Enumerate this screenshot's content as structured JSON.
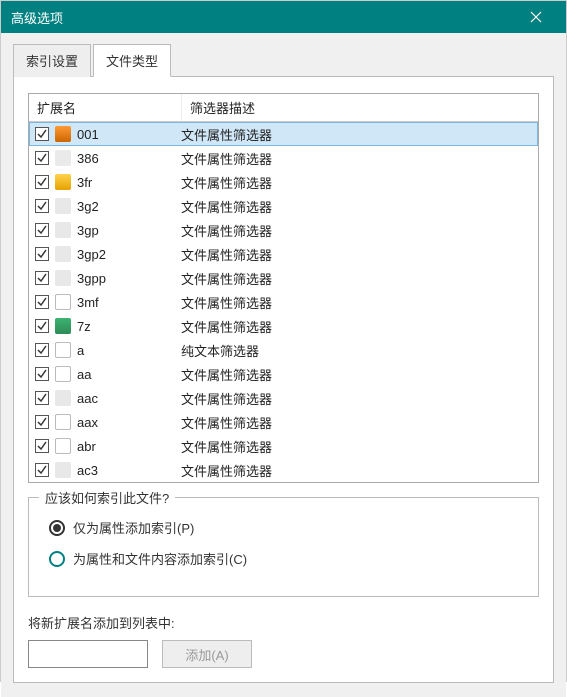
{
  "window": {
    "title": "高级选项"
  },
  "tabs": [
    {
      "label": "索引设置",
      "active": false
    },
    {
      "label": "文件类型",
      "active": true
    }
  ],
  "columns": {
    "ext": "扩展名",
    "desc": "筛选器描述"
  },
  "rows": [
    {
      "checked": true,
      "ext": "001",
      "desc": "文件属性筛选器",
      "icon": "ic-orange",
      "selected": true
    },
    {
      "checked": true,
      "ext": "386",
      "desc": "文件属性筛选器",
      "icon": "ic-gear"
    },
    {
      "checked": true,
      "ext": "3fr",
      "desc": "文件属性筛选器",
      "icon": "ic-yellow"
    },
    {
      "checked": true,
      "ext": "3g2",
      "desc": "文件属性筛选器",
      "icon": "ic-media"
    },
    {
      "checked": true,
      "ext": "3gp",
      "desc": "文件属性筛选器",
      "icon": "ic-media"
    },
    {
      "checked": true,
      "ext": "3gp2",
      "desc": "文件属性筛选器",
      "icon": "ic-media"
    },
    {
      "checked": true,
      "ext": "3gpp",
      "desc": "文件属性筛选器",
      "icon": "ic-media"
    },
    {
      "checked": true,
      "ext": "3mf",
      "desc": "文件属性筛选器",
      "icon": "ic-doc"
    },
    {
      "checked": true,
      "ext": "7z",
      "desc": "文件属性筛选器",
      "icon": "ic-7z"
    },
    {
      "checked": true,
      "ext": "a",
      "desc": "纯文本筛选器",
      "icon": "ic-doc"
    },
    {
      "checked": true,
      "ext": "aa",
      "desc": "文件属性筛选器",
      "icon": "ic-doc"
    },
    {
      "checked": true,
      "ext": "aac",
      "desc": "文件属性筛选器",
      "icon": "ic-media"
    },
    {
      "checked": true,
      "ext": "aax",
      "desc": "文件属性筛选器",
      "icon": "ic-doc"
    },
    {
      "checked": true,
      "ext": "abr",
      "desc": "文件属性筛选器",
      "icon": "ic-doc"
    },
    {
      "checked": true,
      "ext": "ac3",
      "desc": "文件属性筛选器",
      "icon": "ic-media"
    }
  ],
  "index_group": {
    "title": "应该如何索引此文件?",
    "opts": [
      {
        "label": "仅为属性添加索引(P)",
        "selected": true
      },
      {
        "label": "为属性和文件内容添加索引(C)",
        "selected": false
      }
    ]
  },
  "add_section": {
    "label": "将新扩展名添加到列表中:",
    "button": "添加(A)",
    "input_value": ""
  }
}
